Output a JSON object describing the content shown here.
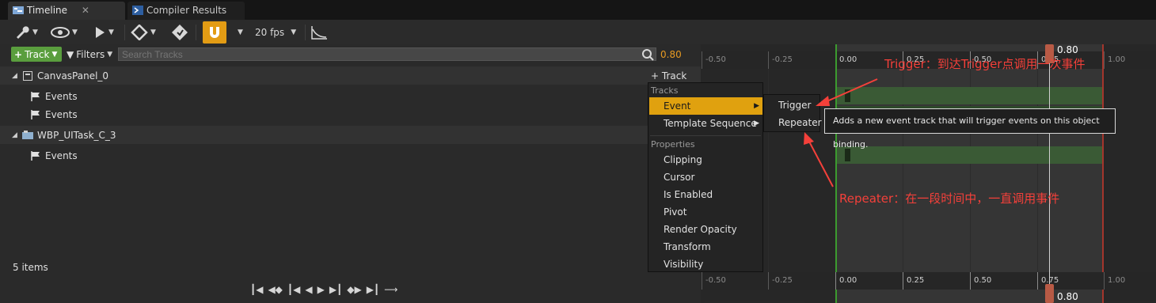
{
  "tabs": [
    {
      "label": "Timeline"
    },
    {
      "label": "Compiler Results"
    }
  ],
  "toolbar": {
    "fps_label": "20 fps",
    "accent_color": "#e39c14"
  },
  "filterbar": {
    "track_button": "Track",
    "filters_button": "Filters",
    "search_placeholder": "Search Tracks",
    "playhead_value": "0.80"
  },
  "tree": {
    "rows": [
      {
        "label": "CanvasPanel_0",
        "track_button": "Track"
      },
      {
        "label": "Events"
      },
      {
        "label": "Events"
      },
      {
        "label": "WBP_UITask_C_3"
      },
      {
        "label": "Events"
      }
    ],
    "items_count": "5 items"
  },
  "ruler": {
    "ticks": [
      "-0.50",
      "-0.25",
      "0.00",
      "0.25",
      "0.50",
      "0.75",
      "1.00"
    ],
    "playhead_label": "0.80"
  },
  "menu": {
    "tracks_header": "Tracks",
    "items_tracks": [
      "Event",
      "Template Sequence"
    ],
    "properties_header": "Properties",
    "items_properties": [
      "Clipping",
      "Cursor",
      "Is Enabled",
      "Pivot",
      "Render Opacity",
      "Transform",
      "Visibility"
    ]
  },
  "submenu": {
    "items": [
      "Trigger",
      "Repeater"
    ]
  },
  "tooltip": {
    "text": "Adds a new event track that will trigger events on this object binding."
  },
  "annotations": {
    "trigger": "Trigger：到达Trigger点调用一次事件",
    "repeater": "Repeater：在一段时间中，一直调用事件",
    "color": "#f4403a"
  }
}
